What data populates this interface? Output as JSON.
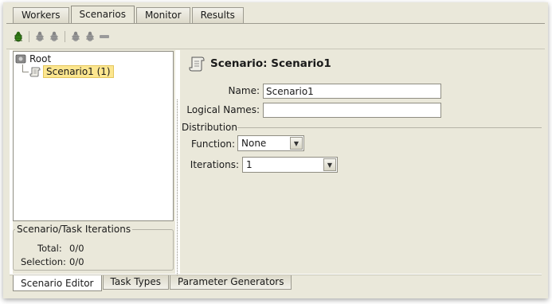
{
  "top_tabs": [
    {
      "label": "Workers"
    },
    {
      "label": "Scenarios"
    },
    {
      "label": "Monitor"
    },
    {
      "label": "Results"
    }
  ],
  "active_top_tab": "Scenarios",
  "toolbar": {
    "icons": [
      "add-bug-icon",
      "bug-icon",
      "bug-icon",
      "bug-icon",
      "bug-icon",
      "remove-icon"
    ]
  },
  "tree": {
    "root_label": "Root",
    "child_label": "Scenario1 (1)"
  },
  "iterations_panel": {
    "title": "Scenario/Task Iterations",
    "total_label": "Total:",
    "total_value": "0/0",
    "selection_label": "Selection:",
    "selection_value": "0/0"
  },
  "editor": {
    "title": "Scenario: Scenario1",
    "name_label": "Name:",
    "name_value": "Scenario1",
    "logical_names_label": "Logical Names:",
    "logical_names_value": "",
    "distribution_label": "Distribution",
    "function_label": "Function:",
    "function_value": "None",
    "iterations_label": "Iterations:",
    "iterations_value": "1"
  },
  "bottom_tabs": [
    {
      "label": "Scenario Editor"
    },
    {
      "label": "Task Types"
    },
    {
      "label": "Parameter Generators"
    }
  ],
  "active_bottom_tab": "Scenario Editor",
  "colors": {
    "panel_bg": "#eae8da",
    "selection_bg": "#fce68f",
    "bug_green": "#3a8a1c",
    "bug_disabled": "#9a9a9a"
  }
}
